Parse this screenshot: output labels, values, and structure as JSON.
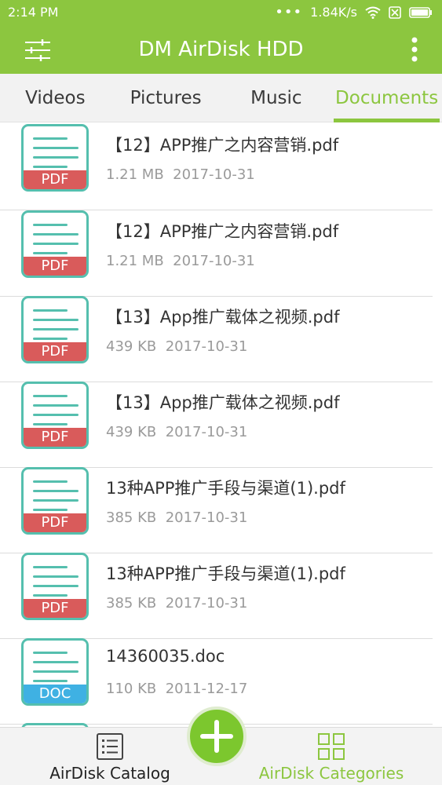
{
  "status_bar": {
    "time": "2:14 PM",
    "speed": "1.84K/s"
  },
  "app_bar": {
    "title": "DM AirDisk HDD",
    "menu_icon": "sliders-icon",
    "more_icon": "more-vert-icon"
  },
  "tabs": [
    {
      "label": "Videos",
      "active": false
    },
    {
      "label": "Pictures",
      "active": false
    },
    {
      "label": "Music",
      "active": false
    },
    {
      "label": "Documents",
      "active": true
    }
  ],
  "files": [
    {
      "name": "【12】APP推广之内容营销.pdf",
      "size": "1.21 MB",
      "date": "2017-10-31",
      "type": "PDF"
    },
    {
      "name": "【12】APP推广之内容营销.pdf",
      "size": "1.21 MB",
      "date": "2017-10-31",
      "type": "PDF"
    },
    {
      "name": "【13】App推广载体之视频.pdf",
      "size": "439 KB",
      "date": "2017-10-31",
      "type": "PDF"
    },
    {
      "name": "【13】App推广载体之视频.pdf",
      "size": "439 KB",
      "date": "2017-10-31",
      "type": "PDF"
    },
    {
      "name": "13种APP推广手段与渠道(1).pdf",
      "size": "385 KB",
      "date": "2017-10-31",
      "type": "PDF"
    },
    {
      "name": "13种APP推广手段与渠道(1).pdf",
      "size": "385 KB",
      "date": "2017-10-31",
      "type": "PDF"
    },
    {
      "name": "14360035.doc",
      "size": "110 KB",
      "date": "2011-12-17",
      "type": "DOC"
    }
  ],
  "bottom_nav": {
    "catalog_label": "AirDisk Catalog",
    "categories_label": "AirDisk Categories",
    "fab_icon": "plus-icon"
  },
  "colors": {
    "accent": "#8cc63f",
    "pdf": "#d95b5b",
    "doc": "#3fb1e3",
    "icon_stroke": "#55bfae"
  }
}
